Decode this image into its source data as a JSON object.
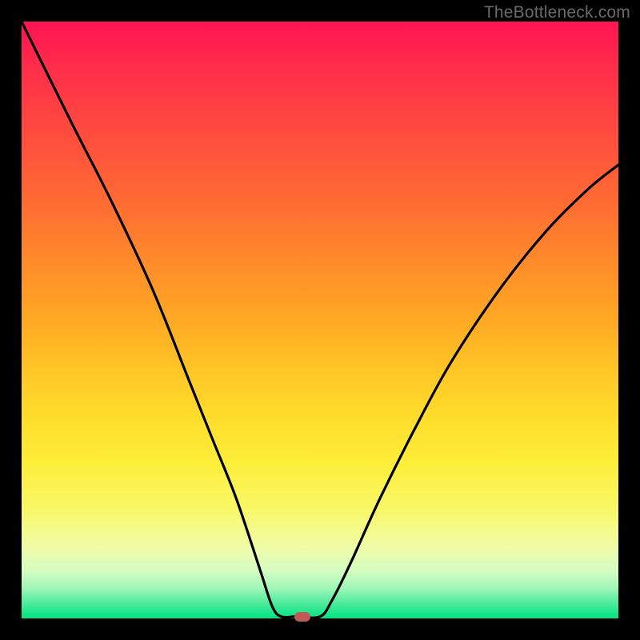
{
  "watermark": "TheBottleneck.com",
  "colors": {
    "frame": "#000000",
    "marker": "#bf5a55",
    "curve": "#000000"
  },
  "chart_data": {
    "type": "line",
    "title": "",
    "xlabel": "",
    "ylabel": "",
    "xlim": [
      0,
      100
    ],
    "ylim": [
      0,
      100
    ],
    "grid": false,
    "legend": false,
    "series": [
      {
        "name": "bottleneck-curve",
        "x": [
          0,
          8.4,
          15,
          22,
          28,
          32,
          36,
          40,
          42,
          43.5,
          46,
          50,
          52,
          55,
          60,
          66,
          72,
          80,
          88,
          95,
          100
        ],
        "y": [
          100,
          83,
          70,
          55,
          40,
          30,
          20,
          8,
          2,
          0.3,
          0.3,
          0.3,
          3,
          9,
          20,
          32,
          43,
          55,
          65,
          72,
          76
        ]
      }
    ],
    "markers": [
      {
        "name": "optimum-point",
        "x": 47,
        "y": 0.3
      }
    ]
  }
}
